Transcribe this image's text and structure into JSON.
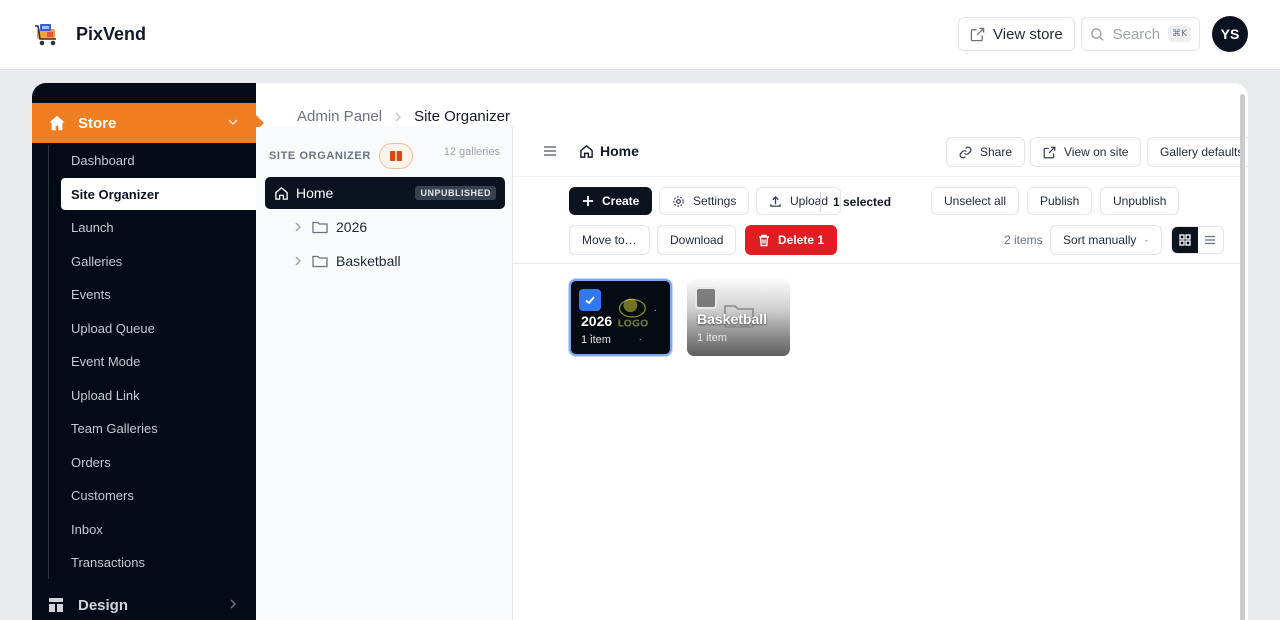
{
  "app": {
    "name": "PixVend"
  },
  "topbar": {
    "view_store": "View store",
    "search_placeholder": "Search",
    "search_shortcut": "⌘K",
    "avatar_initials": "YS"
  },
  "sidebar": {
    "section": "Store",
    "items": [
      {
        "label": "Dashboard"
      },
      {
        "label": "Site Organizer"
      },
      {
        "label": "Launch"
      },
      {
        "label": "Galleries"
      },
      {
        "label": "Events"
      },
      {
        "label": "Upload Queue"
      },
      {
        "label": "Event Mode"
      },
      {
        "label": "Upload Link"
      },
      {
        "label": "Team Galleries"
      },
      {
        "label": "Orders"
      },
      {
        "label": "Customers"
      },
      {
        "label": "Inbox"
      },
      {
        "label": "Transactions"
      }
    ],
    "active_item": "Site Organizer",
    "next_section": "Design"
  },
  "breadcrumb": {
    "root": "Admin Panel",
    "current": "Site Organizer"
  },
  "tree": {
    "title": "SITE ORGANIZER",
    "count": "12 galleries",
    "root": {
      "label": "Home",
      "badge": "UNPUBLISHED"
    },
    "children": [
      {
        "label": "2026"
      },
      {
        "label": "Basketball"
      }
    ]
  },
  "content": {
    "title": "Home",
    "header_buttons": {
      "share": "Share",
      "view_on_site": "View on site",
      "gallery_defaults": "Gallery defaults"
    },
    "toolbar": {
      "create": "Create",
      "settings": "Settings",
      "upload": "Upload",
      "selected": "1 selected",
      "unselect_all": "Unselect all",
      "publish": "Publish",
      "unpublish": "Unpublish",
      "move_to": "Move to…",
      "download": "Download",
      "delete": "Delete 1",
      "items_count": "2 items",
      "sort": "Sort manually"
    },
    "cards": [
      {
        "title": "2026",
        "subtitle": "1 item",
        "selected": true,
        "thumbnail_text": "LOGO"
      },
      {
        "title": "Basketball",
        "subtitle": "1 item",
        "selected": false
      }
    ]
  },
  "colors": {
    "accent": "#ef7d22",
    "sidebar_bg": "#050b16",
    "primary": "#0b1220",
    "danger": "#e11d24",
    "selection": "#2f7af0"
  }
}
